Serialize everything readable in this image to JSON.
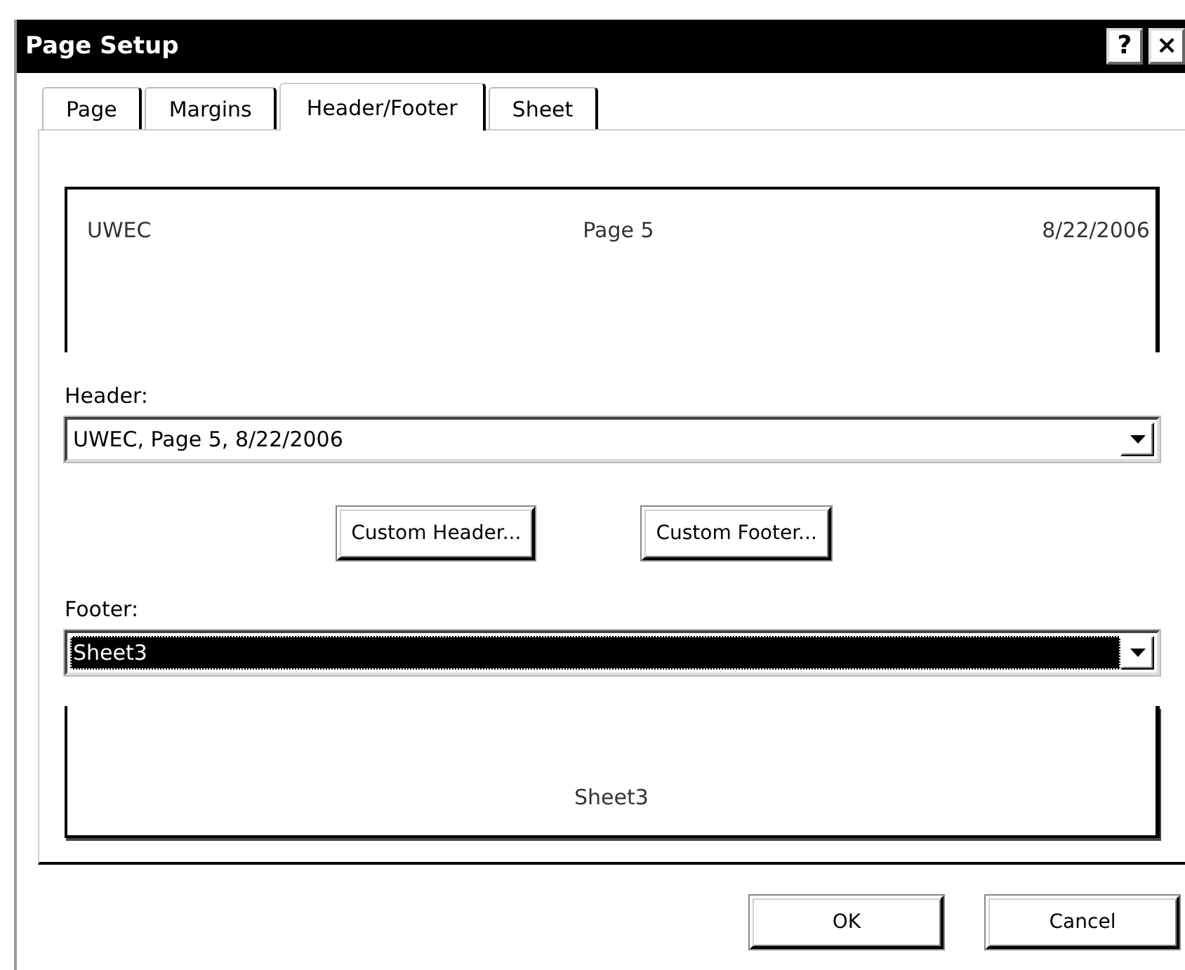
{
  "window": {
    "title": "Page Setup",
    "title_buttons": [
      "?",
      "×"
    ]
  },
  "tabs": [
    {
      "label": "Page",
      "selected": false
    },
    {
      "label": "Margins",
      "selected": false
    },
    {
      "label": "Header/Footer",
      "selected": true
    },
    {
      "label": "Sheet",
      "selected": false
    }
  ],
  "header_preview": {
    "left": "UWEC",
    "center": "Page 5",
    "right": "8/22/2006"
  },
  "header": {
    "label": "Header:",
    "value": "UWEC, Page 5, 8/22/2006",
    "selected": false
  },
  "custom_buttons": [
    "Custom Header...",
    "Custom Footer..."
  ],
  "footer": {
    "label": "Footer:",
    "value": "Sheet3",
    "selected": true
  },
  "footer_preview": {
    "center": "Sheet3"
  },
  "buttons": [
    "OK",
    "Cancel"
  ]
}
